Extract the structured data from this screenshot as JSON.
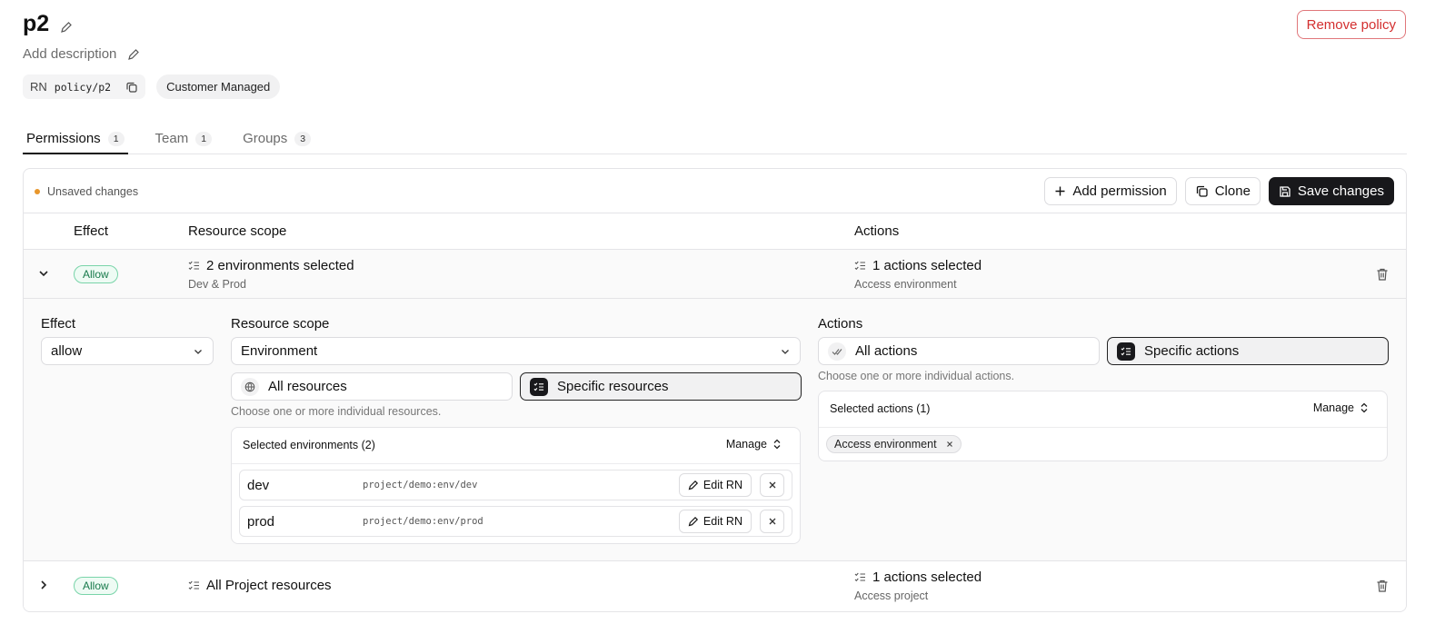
{
  "header": {
    "title": "p2",
    "description_placeholder": "Add description",
    "remove_label": "Remove policy",
    "rn_label": "RN",
    "rn_value": "policy/p2",
    "managed_label": "Customer Managed"
  },
  "tabs": [
    {
      "label": "Permissions",
      "count": "1"
    },
    {
      "label": "Team",
      "count": "1"
    },
    {
      "label": "Groups",
      "count": "3"
    }
  ],
  "toolbar": {
    "unsaved": "Unsaved changes",
    "add_permission": "Add permission",
    "clone": "Clone",
    "save": "Save changes"
  },
  "table": {
    "headers": {
      "effect": "Effect",
      "resource_scope": "Resource scope",
      "actions": "Actions"
    },
    "rows": [
      {
        "effect": "Allow",
        "scope_main": "2 environments selected",
        "scope_sub": "Dev & Prod",
        "actions_main": "1 actions selected",
        "actions_sub": "Access environment"
      },
      {
        "effect": "Allow",
        "scope_main": "All Project resources",
        "actions_main": "1 actions selected",
        "actions_sub": "Access project"
      }
    ]
  },
  "editor": {
    "effect_label": "Effect",
    "effect_value": "allow",
    "scope_label": "Resource scope",
    "scope_value": "Environment",
    "all_resources": "All resources",
    "specific_resources": "Specific resources",
    "resources_hint": "Choose one or more individual resources.",
    "selected_envs_title": "Selected environments (2)",
    "manage": "Manage",
    "environments": [
      {
        "name": "dev",
        "rn": "project/demo:env/dev"
      },
      {
        "name": "prod",
        "rn": "project/demo:env/prod"
      }
    ],
    "edit_rn": "Edit RN",
    "actions_label": "Actions",
    "all_actions": "All actions",
    "specific_actions": "Specific actions",
    "actions_hint": "Choose one or more individual actions.",
    "selected_actions_title": "Selected actions (1)",
    "selected_actions": [
      "Access environment"
    ]
  },
  "colors": {
    "accent_dark": "#18181b",
    "danger": "#d32f2f",
    "allow_green": "#177a4b",
    "unsaved_dot": "#e8962b"
  }
}
